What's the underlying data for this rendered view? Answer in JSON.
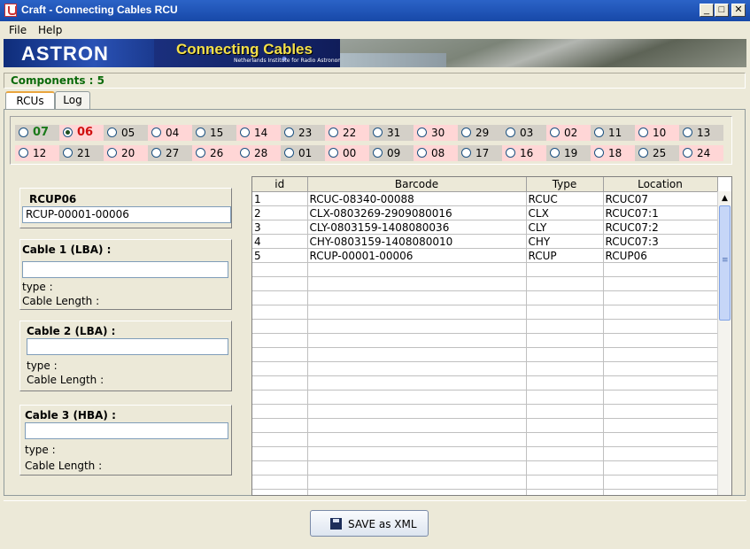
{
  "window": {
    "title": "Craft - Connecting Cables RCU",
    "buttons": [
      "_",
      "□",
      "✕"
    ]
  },
  "menu": {
    "items": [
      "File",
      "Help"
    ]
  },
  "banner": {
    "logo": "ASTRON",
    "title": "Connecting Cables",
    "subtitle": "Netherlands Institute for Radio Astronomy"
  },
  "status": {
    "components": "Components : 5"
  },
  "tabs": [
    {
      "label": "RCUs",
      "active": true
    },
    {
      "label": "Log",
      "active": false
    }
  ],
  "rcu_grid": {
    "selected": "06",
    "rows": [
      [
        {
          "n": "07",
          "color": "green",
          "bg": "gray"
        },
        {
          "n": "06",
          "color": "red",
          "bg": "pink",
          "checked": true
        },
        {
          "n": "05",
          "bg": "gray"
        },
        {
          "n": "04",
          "bg": "pink"
        },
        {
          "n": "15",
          "bg": "gray"
        },
        {
          "n": "14",
          "bg": "pink"
        },
        {
          "n": "23",
          "bg": "gray"
        },
        {
          "n": "22",
          "bg": "pink"
        },
        {
          "n": "31",
          "bg": "gray"
        },
        {
          "n": "30",
          "bg": "pink"
        },
        {
          "n": "29",
          "bg": "gray"
        },
        {
          "n": "03",
          "bg": "gray"
        },
        {
          "n": "02",
          "bg": "pink"
        },
        {
          "n": "11",
          "bg": "gray"
        },
        {
          "n": "10",
          "bg": "pink"
        },
        {
          "n": "13",
          "bg": "gray"
        }
      ],
      [
        {
          "n": "12",
          "bg": "pink"
        },
        {
          "n": "21",
          "bg": "gray"
        },
        {
          "n": "20",
          "bg": "pink"
        },
        {
          "n": "27",
          "bg": "gray"
        },
        {
          "n": "26",
          "bg": "pink"
        },
        {
          "n": "28",
          "bg": "pink"
        },
        {
          "n": "01",
          "bg": "gray"
        },
        {
          "n": "00",
          "bg": "pink"
        },
        {
          "n": "09",
          "bg": "gray"
        },
        {
          "n": "08",
          "bg": "pink"
        },
        {
          "n": "17",
          "bg": "gray"
        },
        {
          "n": "16",
          "bg": "pink"
        },
        {
          "n": "19",
          "bg": "gray"
        },
        {
          "n": "18",
          "bg": "pink"
        },
        {
          "n": "25",
          "bg": "gray"
        },
        {
          "n": "24",
          "bg": "pink"
        }
      ]
    ]
  },
  "rcup": {
    "title": "RCUP06",
    "value": "RCUP-00001-00006"
  },
  "cables": [
    {
      "title": "Cable 1 (LBA) :",
      "value": "",
      "type_label": "type :",
      "length_label": "Cable Length :"
    },
    {
      "title": "Cable 2  (LBA) :",
      "value": "",
      "type_label": "type :",
      "length_label": "Cable Length :"
    },
    {
      "title": "Cable 3 (HBA) :",
      "value": "",
      "type_label": "type :",
      "length_label": "Cable Length :"
    }
  ],
  "table": {
    "columns": [
      "id",
      "Barcode",
      "Type",
      "Location"
    ],
    "rows": [
      [
        "1",
        "RCUC-08340-00088",
        "RCUC",
        "RCUC07"
      ],
      [
        "2",
        "CLX-0803269-2909080016",
        "CLX",
        "RCUC07:1"
      ],
      [
        "3",
        "CLY-0803159-1408080036",
        "CLY",
        "RCUC07:2"
      ],
      [
        "4",
        "CHY-0803159-1408080010",
        "CHY",
        "RCUC07:3"
      ],
      [
        "5",
        "RCUP-00001-00006",
        "RCUP",
        "RCUP06"
      ]
    ],
    "empty_rows": 17
  },
  "actions": {
    "save_label": "SAVE as XML"
  },
  "colors": {
    "gray": "#d4d0c8",
    "pink": "#ffd6d6",
    "green": "#1a7a1a",
    "red": "#d01010",
    "components": "#0a6a0a"
  }
}
